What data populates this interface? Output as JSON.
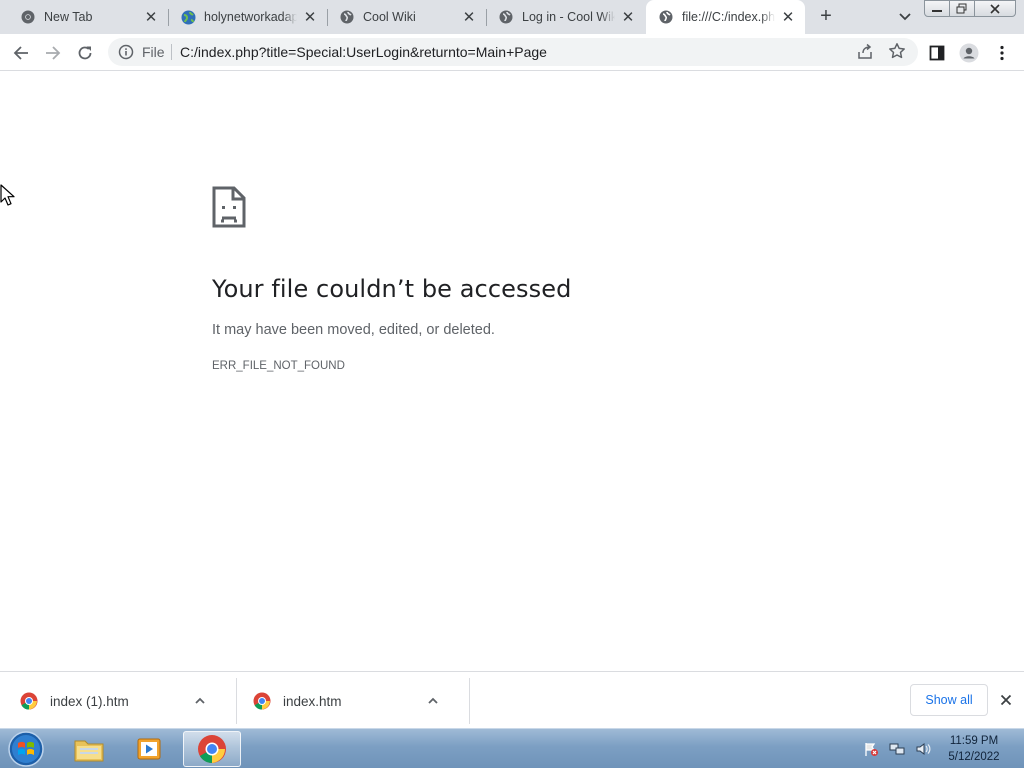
{
  "browser": {
    "tabs": [
      {
        "title": "New Tab",
        "icon": "chrome-icon",
        "active": false
      },
      {
        "title": "holynetworkadapter",
        "icon": "globe-icon",
        "active": false
      },
      {
        "title": "Cool Wiki",
        "icon": "globe-icon",
        "active": false
      },
      {
        "title": "Log in - Cool Wiki",
        "icon": "globe-icon",
        "active": false
      },
      {
        "title": "file:///C:/index.php",
        "icon": "globe-icon",
        "active": true
      }
    ],
    "new_tab_label": "+",
    "omnibox": {
      "scheme_chip": "File",
      "url": "C:/index.php?title=Special:UserLogin&returnto=Main+Page"
    }
  },
  "error_page": {
    "title": "Your file couldn’t be accessed",
    "message": "It may have been moved, edited, or deleted.",
    "code": "ERR_FILE_NOT_FOUND"
  },
  "downloads": {
    "items": [
      {
        "name": "index (1).htm",
        "icon": "chrome-icon"
      },
      {
        "name": "index.htm",
        "icon": "chrome-icon"
      }
    ],
    "show_all_label": "Show all"
  },
  "taskbar": {
    "apps": [
      "explorer-icon",
      "media-player-icon",
      "chrome-icon"
    ],
    "clock": {
      "time": "11:59 PM",
      "date": "5/12/2022"
    }
  },
  "colors": {
    "accent": "#1a73e8",
    "tab_strip": "#dee1e6",
    "omnibox": "#f1f3f4"
  }
}
